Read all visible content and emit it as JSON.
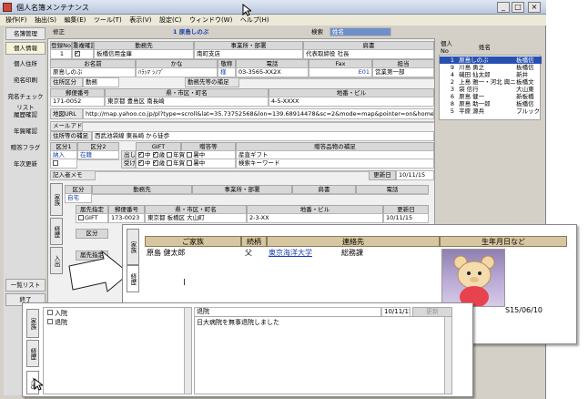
{
  "window": {
    "title": "個人名簿メンテナンス",
    "menu": [
      "操作(F)",
      "抽出(S)",
      "編集(E)",
      "ツール(T)",
      "表示(V)",
      "設定(C)",
      "ウィンドウ(W)",
      "ヘルプ(H)"
    ],
    "minimize": "_",
    "maximize": "□",
    "close": "×"
  },
  "sidebar": {
    "items": [
      "名簿管理",
      "個人情報",
      "個人住所",
      "宛名印刷",
      "宛名チェックリスト",
      "履歴確認",
      "年賀確認",
      "贈答フラグ",
      "年次更新",
      "一覧リスト",
      "終了"
    ]
  },
  "header": {
    "mode_label": "修正",
    "record_label": "1 原島しのぶ",
    "search_label": "検索",
    "search_value": "姓名"
  },
  "main": {
    "col_headers": [
      "登録No",
      "重複確認",
      "勤務先",
      "事業所・部署",
      "肩書"
    ],
    "row1": [
      "1",
      "",
      "板橋信用金庫",
      "南町支店",
      "代表取締役 社長"
    ],
    "col_headers2": [
      "お名前",
      "かな",
      "敬称",
      "電話",
      "Fax",
      "担当"
    ],
    "row2": [
      "原島しのぶ",
      "ﾊﾗｼﾏ ｼﾉﾌﾞ",
      "様",
      "03-3565-XX2X",
      "E01",
      "営業第一部"
    ],
    "tabs": [
      "住所区分",
      "勤務",
      "勤務先等の補足"
    ],
    "addr_headers": [
      "郵便番号",
      "県・市区・町名",
      "地番・ビル"
    ],
    "addr_row": [
      "171-0052",
      "東京都 豊島区 南長崎",
      "4-5-XXXX"
    ],
    "map_label": "地図URL",
    "map_url": "http://map.yahoo.co.jp/pl?type=scroll&lat=35.73752568&lon=139.68914478&sc=2&mode=map&pointer=on&home=on&hlat=35.739",
    "mail_label": "メールアドレス",
    "subtabs": [
      "住所等の補足",
      "西武池袋線 東長崎 から徒歩"
    ],
    "grp_headers": [
      "区分1",
      "区分2",
      "GIFT",
      "贈答等",
      "贈答品物の補足"
    ],
    "grp_row1": [
      "納入",
      "在籍",
      "出し",
      "中",
      "歳",
      "年賀",
      "暑中",
      "産直ギフト"
    ],
    "grp_row2": [
      "",
      "",
      "受け",
      "中",
      "歳",
      "年賀",
      "暑中",
      "検索キーワード"
    ],
    "memo_label": "記入者メモ",
    "update_btn": "更新日",
    "update_date": "10/11/15"
  },
  "lower": {
    "tab_family": "家族",
    "tab_history": "経歴",
    "tab_inout": "入出",
    "col_headers": [
      "区分",
      "勤務先",
      "事業所・部署",
      "肩書",
      "電話"
    ],
    "row_home": "自宅",
    "sub_headers": [
      "届先指定",
      "郵便番号",
      "県・市区・町名",
      "地番・ビル",
      "更新日"
    ],
    "sub_row": [
      "GIFT",
      "贈状",
      "173-0023",
      "東京都 板橋区 大山町",
      "2-3-XX",
      "10/11/15"
    ],
    "kubun": "区分",
    "todoke": "届先指定"
  },
  "right_list": {
    "headers": [
      "個人No",
      "姓名"
    ],
    "rows": [
      {
        "no": "1",
        "name": "原島しのぶ",
        "extra": "板橋信"
      },
      {
        "no": "9",
        "name": "川島 勇之",
        "extra": "板橋信"
      },
      {
        "no": "4",
        "name": "磯田 仙太郎",
        "extra": "新井"
      },
      {
        "no": "2",
        "name": "上島 雅一・河北 興ニ",
        "extra": "板橋文"
      },
      {
        "no": "3",
        "name": "袋 信行",
        "extra": "大山東"
      },
      {
        "no": "6",
        "name": "原島 健一",
        "extra": "新板橋"
      },
      {
        "no": "8",
        "name": "原島 助一郎",
        "extra": "板橋信"
      },
      {
        "no": "5",
        "name": "平原 源兵",
        "extra": "ブルック"
      }
    ]
  },
  "family_panel": {
    "tab1": "家族",
    "tab2": "経歴",
    "headers": [
      "ご家族",
      "続柄",
      "連絡先",
      "生年月日など"
    ],
    "row": [
      "原島 健太郎",
      "父",
      "東京海洋大学",
      "総務課",
      "S15/06/10"
    ]
  },
  "history_panel": {
    "tab1": "家族",
    "tab2": "経歴",
    "tab3": "入出",
    "items": [
      "入院",
      "退院"
    ],
    "detail_title": "退院",
    "detail_date": "10/11/15",
    "detail_button": "更新",
    "detail_text": "日大病院を無事退院しました"
  },
  "colors": {
    "header_tan": "#d7c7a0",
    "blue_text": "#1a3fb0",
    "selected_row": "#2850b0"
  }
}
